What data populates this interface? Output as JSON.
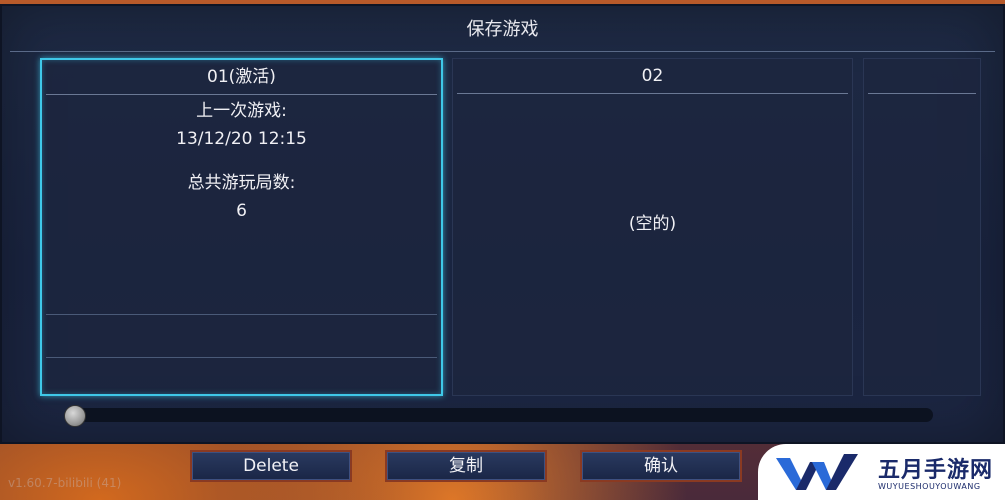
{
  "dialog": {
    "title": "保存游戏"
  },
  "slots": [
    {
      "name": "01(激活)",
      "last_played_label": "上一次游戏:",
      "last_played_value": "13/12/20 12:15",
      "total_games_label": "总共游玩局数:",
      "total_games_value": "6",
      "active": true
    },
    {
      "name": "02",
      "status": "(空的)"
    },
    {
      "name": ""
    }
  ],
  "buttons": {
    "delete": "Delete",
    "copy": "复制",
    "confirm": "确认"
  },
  "version_text": "v1.60.7-bilibili (41)",
  "watermark": {
    "cn": "五月手游网",
    "en": "WUYUESHOUYOUWANG"
  },
  "colors": {
    "active_border": "#3fc8e8",
    "button_border": "#8a3a22",
    "panel_bg": "#1e2a44"
  },
  "scrollbar": {
    "position": 0
  }
}
